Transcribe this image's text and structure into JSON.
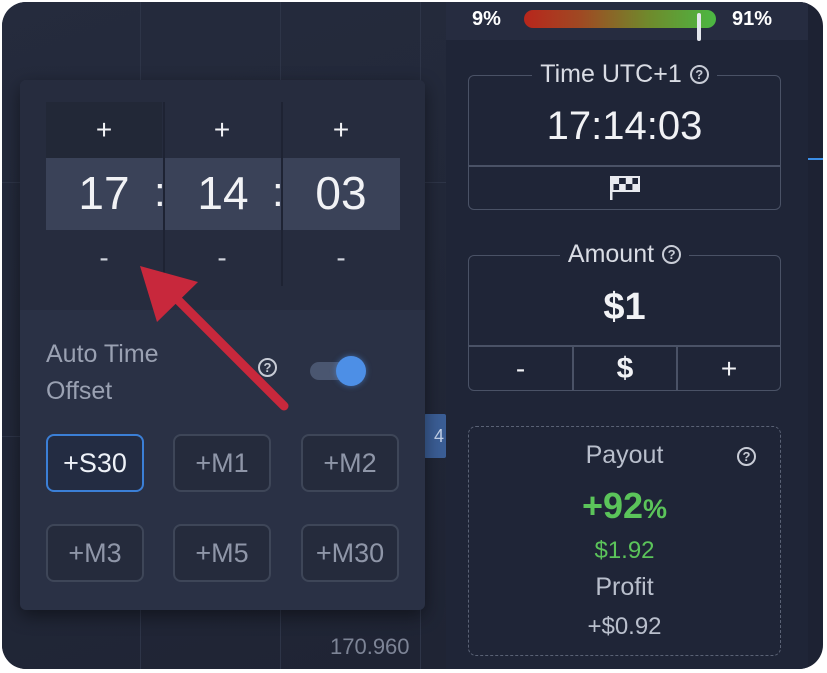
{
  "sentiment": {
    "left_pct": "9%",
    "right_pct": "91%",
    "value": 0.91
  },
  "chart": {
    "price_label": "170.960",
    "mark_label": "4"
  },
  "time_box": {
    "legend": "Time UTC+1",
    "value": "17:14:03",
    "flag_icon": "checkered-flag-icon"
  },
  "amount_box": {
    "legend": "Amount",
    "value": "$1",
    "minus": "-",
    "currency": "$",
    "plus": "+"
  },
  "payout_box": {
    "label": "Payout",
    "percent": "+92",
    "percent_sign": "%",
    "amount": "$1.92",
    "profit_label": "Profit",
    "profit": "+$0.92",
    "accent_color": "#5bc45a"
  },
  "time_picker": {
    "plus": "+",
    "minus": "-",
    "hours": "17",
    "minutes": "14",
    "seconds": "03",
    "separator": ":",
    "auto_offset_label_1": "Auto Time",
    "auto_offset_label_2": "Offset",
    "auto_offset_enabled": true,
    "offsets": [
      "+S30",
      "+M1",
      "+M2",
      "+M3",
      "+M5",
      "+M30"
    ],
    "active_offset": "+S30"
  },
  "help_glyph": "?",
  "colors": {
    "accent_blue": "#3b7fd6",
    "arrow_red": "#c8283c",
    "bg": "#1f2537"
  }
}
